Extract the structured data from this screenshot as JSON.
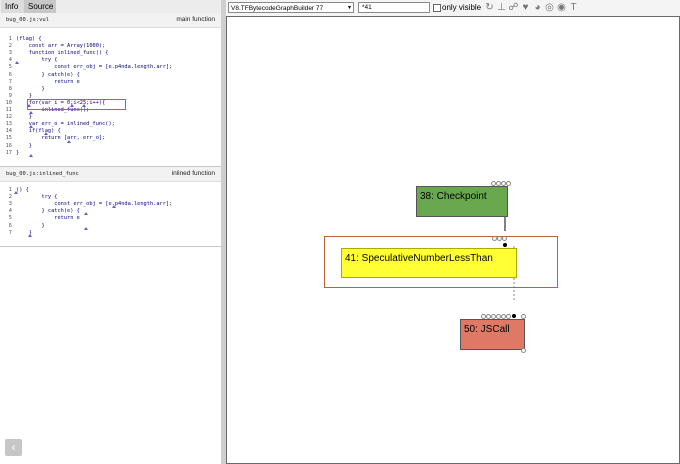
{
  "tabs": {
    "info": "Info",
    "source": "Source"
  },
  "main_section": {
    "file": "bug_00.js:vul",
    "kind": "main function"
  },
  "inlined_section": {
    "file": "bug_00.js:inlined_func",
    "kind": "inlined function"
  },
  "main_code": [
    {
      "ln": "1",
      "text": "(flag) {"
    },
    {
      "ln": "2",
      "text": "    const arr = Array(1000);"
    },
    {
      "ln": "3",
      "text": "    function inlined_func() {"
    },
    {
      "ln": "4",
      "text": "        try {"
    },
    {
      "ln": "5",
      "text": "            const err_obj = [e.p4nda.length.arr];"
    },
    {
      "ln": "6",
      "text": "        } catch(e) {"
    },
    {
      "ln": "7",
      "text": "            return e"
    },
    {
      "ln": "8",
      "text": "        }"
    },
    {
      "ln": "9",
      "text": "    }"
    },
    {
      "ln": "10",
      "text": "    for(var i = 0;i<25;i++){"
    },
    {
      "ln": "11",
      "text": "        inlined_func();"
    },
    {
      "ln": "12",
      "text": "    }"
    },
    {
      "ln": "13",
      "text": "    var err_o = inlined_func();"
    },
    {
      "ln": "14",
      "text": "    if(flag) {"
    },
    {
      "ln": "15",
      "text": "        return [arr, err_o];"
    },
    {
      "ln": "16",
      "text": "    }"
    },
    {
      "ln": "17",
      "text": "}"
    }
  ],
  "inlined_code": [
    {
      "ln": "1",
      "text": "() {"
    },
    {
      "ln": "2",
      "text": "        try {"
    },
    {
      "ln": "3",
      "text": "            const err_obj = [e.p4nda.length.arr];"
    },
    {
      "ln": "4",
      "text": "        } catch(e) {"
    },
    {
      "ln": "5",
      "text": "            return e"
    },
    {
      "ln": "6",
      "text": "        }"
    },
    {
      "ln": "7",
      "text": "    }"
    }
  ],
  "toolbar": {
    "phase_select": "V8.TFBytecodeGraphBuilder 77",
    "search_value": "*41",
    "only_visible_label": "only visible",
    "icons": [
      "layout-icon",
      "show-all-icon",
      "toggle-types-icon",
      "hide-unselected-icon",
      "hide-selected-icon",
      "zoom-icon",
      "toggle-visibility-icon",
      "types-icon"
    ]
  },
  "graph": {
    "nodes": [
      {
        "id": "checkpoint",
        "label": "38: Checkpoint",
        "color": "#6aa84f"
      },
      {
        "id": "spec",
        "label": "41: SpeculativeNumberLessThan",
        "color": "#ffff33"
      },
      {
        "id": "jscall",
        "label": "50: JSCall",
        "color": "#e07866"
      }
    ],
    "selection_color": "#c0603a"
  }
}
